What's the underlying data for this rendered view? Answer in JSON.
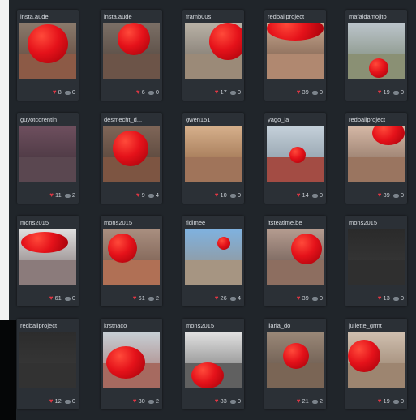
{
  "colors": {
    "background": "#20252a",
    "card": "#2b3036",
    "heart": "#e23744",
    "ball": "#e5121a"
  },
  "posts": [
    {
      "user": "insta.aude",
      "likes": "8",
      "comments": "0"
    },
    {
      "user": "insta.aude",
      "likes": "6",
      "comments": "0"
    },
    {
      "user": "framb00s",
      "likes": "17",
      "comments": "0"
    },
    {
      "user": "redballproject",
      "likes": "39",
      "comments": "0"
    },
    {
      "user": "mafaldamojito",
      "likes": "19",
      "comments": "0"
    },
    {
      "user": "guyotcorentin",
      "likes": "11",
      "comments": "2"
    },
    {
      "user": "desmecht_d...",
      "likes": "9",
      "comments": "4"
    },
    {
      "user": "gwen151",
      "likes": "10",
      "comments": "0"
    },
    {
      "user": "yago_la",
      "likes": "14",
      "comments": "0"
    },
    {
      "user": "redballproject",
      "likes": "39",
      "comments": "0"
    },
    {
      "user": "mons2015",
      "likes": "61",
      "comments": "0"
    },
    {
      "user": "mons2015",
      "likes": "61",
      "comments": "2"
    },
    {
      "user": "fidimee",
      "likes": "26",
      "comments": "4"
    },
    {
      "user": "itsteatime.be",
      "likes": "39",
      "comments": "0"
    },
    {
      "user": "mons2015",
      "likes": "13",
      "comments": "0"
    },
    {
      "user": "redballproject",
      "likes": "12",
      "comments": "0"
    },
    {
      "user": "krstnaco",
      "likes": "30",
      "comments": "2"
    },
    {
      "user": "mons2015",
      "likes": "83",
      "comments": "0"
    },
    {
      "user": "ilaria_do",
      "likes": "21",
      "comments": "2"
    },
    {
      "user": "juliette_grmt",
      "likes": "19",
      "comments": "0"
    }
  ]
}
